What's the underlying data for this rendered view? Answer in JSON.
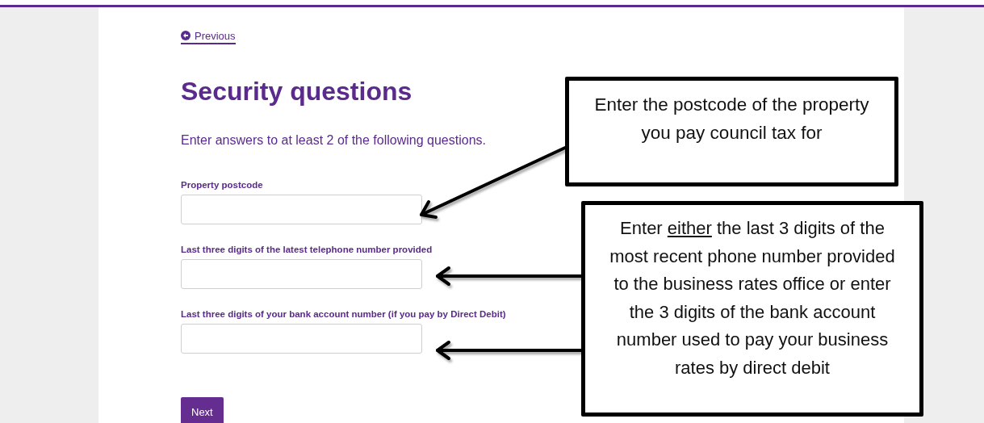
{
  "previous_link": {
    "label": "Previous"
  },
  "heading": "Security questions",
  "intro": "Enter answers to at least 2 of the following questions.",
  "fields": [
    {
      "label": "Property postcode"
    },
    {
      "label": "Last three digits of the latest telephone number provided"
    },
    {
      "label": "Last three digits of your bank account number (if you pay by Direct Debit)"
    }
  ],
  "next_button": "Next",
  "callouts": [
    {
      "before": "Enter the postcode of the property you pay council tax for"
    },
    {
      "before": "Enter ",
      "underlined": "either",
      "after": " the last 3 digits of the most recent phone number provided to the business rates office or enter the 3 digits of the bank account number used to pay your business rates by direct debit"
    }
  ]
}
